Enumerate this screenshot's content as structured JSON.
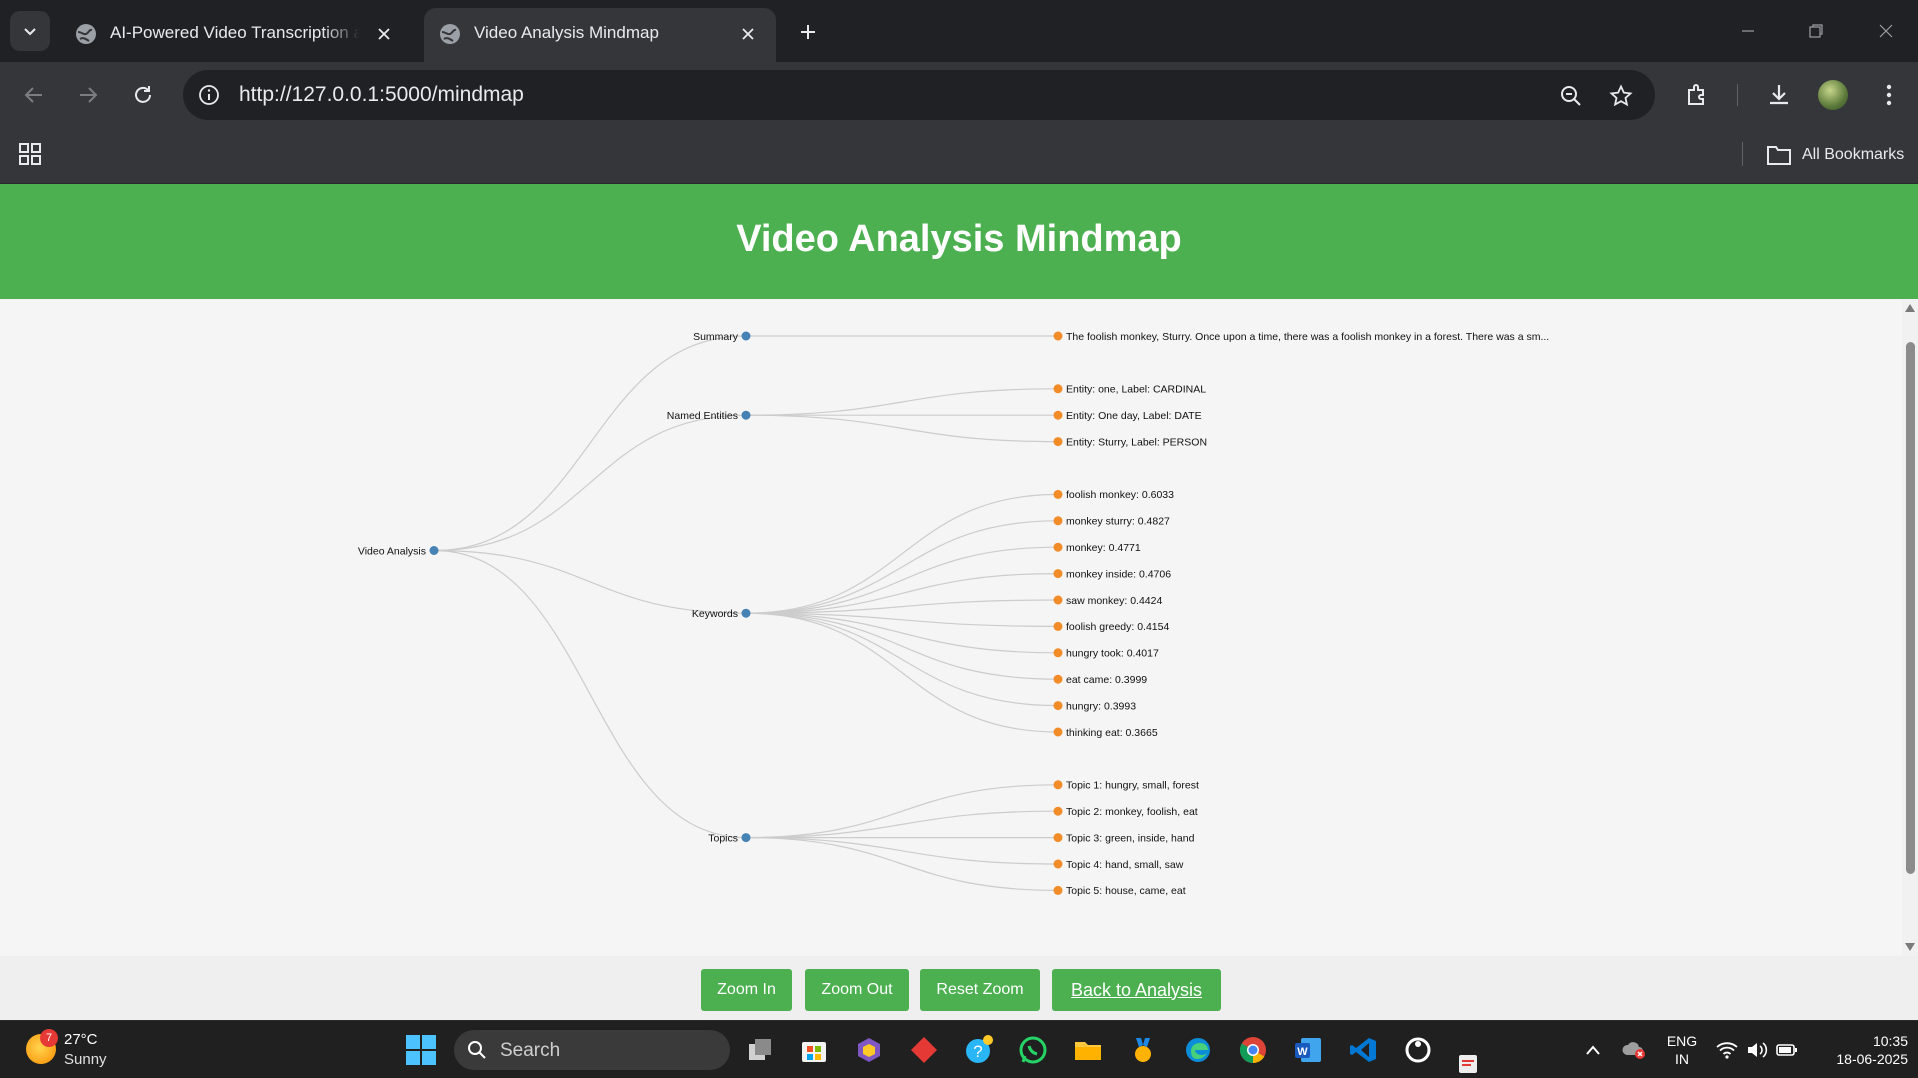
{
  "browser": {
    "tabs": [
      {
        "title": "AI-Powered Video Transcription and Summary",
        "active": false
      },
      {
        "title": "Video Analysis Mindmap",
        "active": true
      }
    ],
    "url": "http://127.0.0.1:5000/mindmap",
    "all_bookmarks": "All Bookmarks"
  },
  "page": {
    "title": "Video Analysis Mindmap",
    "buttons": {
      "zoom_in": "Zoom In",
      "zoom_out": "Zoom Out",
      "reset_zoom": "Reset Zoom",
      "back": "Back to Analysis"
    }
  },
  "mindmap": {
    "root": "Video Analysis",
    "branches": [
      {
        "label": "Summary",
        "children": [
          "The foolish monkey, Sturry. Once upon a time, there was a foolish monkey in a forest. There was a sm..."
        ]
      },
      {
        "label": "Named Entities",
        "children": [
          "Entity: one, Label: CARDINAL",
          "Entity: One day, Label: DATE",
          "Entity: Sturry, Label: PERSON"
        ]
      },
      {
        "label": "Keywords",
        "children": [
          "foolish monkey: 0.6033",
          "monkey sturry: 0.4827",
          "monkey: 0.4771",
          "monkey inside: 0.4706",
          "saw monkey: 0.4424",
          "foolish greedy: 0.4154",
          "hungry took: 0.4017",
          "eat came: 0.3999",
          "hungry: 0.3993",
          "thinking eat: 0.3665"
        ]
      },
      {
        "label": "Topics",
        "children": [
          "Topic 1: hungry, small, forest",
          "Topic 2: monkey, foolish, eat",
          "Topic 3: green, inside, hand",
          "Topic 4: hand, small, saw",
          "Topic 5: house, came, eat"
        ]
      }
    ],
    "colors": {
      "branch_node": "#4682b4",
      "leaf_node": "#f28c28",
      "link": "#cccccc"
    }
  },
  "taskbar": {
    "weather_temp": "27°C",
    "weather_condition": "Sunny",
    "weather_badge": "7",
    "search_placeholder": "Search",
    "language": "ENG",
    "region": "IN",
    "time": "10:35",
    "date": "18-06-2025"
  }
}
